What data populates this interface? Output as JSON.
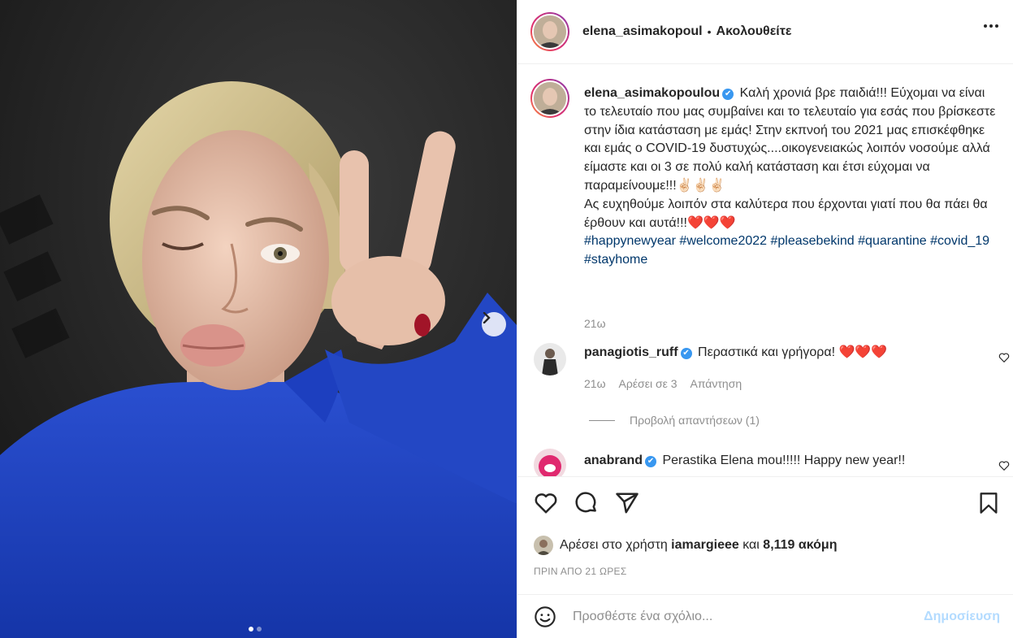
{
  "header": {
    "username": "elena_asimakopoul",
    "separator": "•",
    "follow_label": "Ακολουθείτε",
    "more_icon": "more-horizontal-icon"
  },
  "caption": {
    "username": "elena_asimakopoulou",
    "verified": "✔",
    "text": "Καλή χρονιά βρε παιδιά!!! Εύχομαι να είναι το τελευταίο που μας συμβαίνει και το τελευταίο για εσάς που βρίσκεστε στην ίδια κατάσταση με εμάς! Στην εκπνοή του 2021 μας επισκέφθηκε και εμάς ο COVID-19 δυστυχώς....οικογενειακώς λοιπόν νοσούμε αλλά είμαστε και οι 3 σε πολύ καλή κατάσταση και έτσι εύχομαι να παραμείνουμε!!!✌🏻✌🏻✌🏻",
    "text2": "Ας ευχηθούμε λοιπόν στα καλύτερα που έρχονται γιατί που θα πάει θα έρθουν και αυτά!!!❤️❤️❤️",
    "hashtags": [
      "#happynewyear",
      "#welcome2022",
      "#pleasebekind",
      "#quarantine",
      "#covid_19",
      "#stayhome"
    ],
    "time": "21ω"
  },
  "comments": [
    {
      "username": "panagiotis_ruff",
      "verified": "✔",
      "text": "Περαστικά και γρήγορα! ❤️❤️❤️",
      "time": "21ω",
      "likes": "Αρέσει σε 3",
      "reply": "Απάντηση"
    },
    {
      "username": "anabrand",
      "verified": "✔",
      "text": "Perastika Elena mou!!!!! Happy new year!!"
    }
  ],
  "view_replies": "Προβολή απαντήσεων (1)",
  "likes": {
    "prefix": "Αρέσει στο χρήστη",
    "user": "iamargieee",
    "and": "και",
    "count": "8,119 ακόμη"
  },
  "posted": "ΠΡΙΝ ΑΠΟ 21 ΩΡΕΣ",
  "compose": {
    "placeholder": "Προσθέστε ένα σχόλιο...",
    "post_label": "Δημοσίευση"
  },
  "carousel": {
    "current": 1,
    "total": 2
  },
  "colors": {
    "link": "#00376b",
    "verified": "#3897f0",
    "muted": "#8e8e8e",
    "post_button": "#b3dbff"
  }
}
